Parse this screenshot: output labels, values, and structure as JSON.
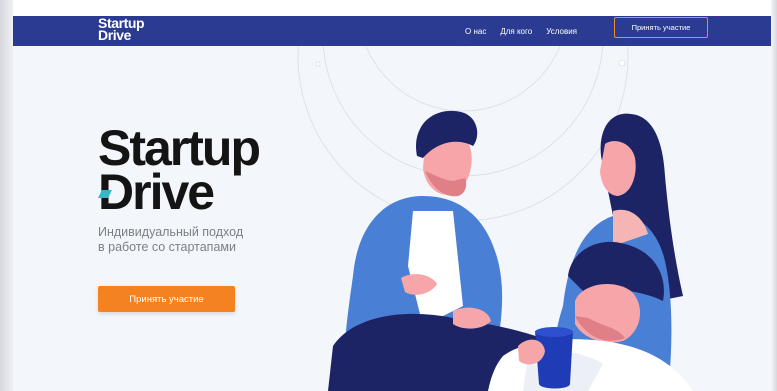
{
  "brand": {
    "nav_logo_line1": "Startup",
    "nav_logo_line2": "Drive",
    "hero_logo_line1": "Startup",
    "hero_logo_line2": "Drive"
  },
  "nav": {
    "links": [
      "О нас",
      "Для кого",
      "Условия"
    ],
    "cta": "Принять участие"
  },
  "hero": {
    "tagline_line1": "Индивидуальный подход",
    "tagline_line2": "в работе со стартапами",
    "cta": "Принять участие"
  },
  "colors": {
    "navbar": "#2b3b92",
    "accent": "#f58220",
    "background": "#f3f6fb",
    "logo": "#141414",
    "logo_accent": "#3bb4c9"
  }
}
